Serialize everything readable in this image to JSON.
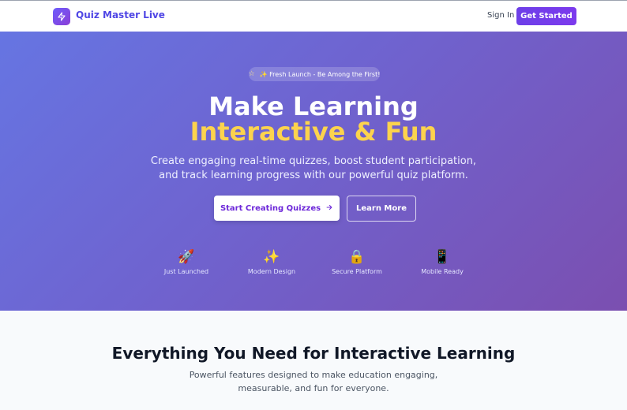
{
  "nav": {
    "brand": "Quiz Master Live",
    "logo_icon": "lightning-bolt-icon",
    "signin": "Sign In",
    "get_started": "Get Started"
  },
  "hero": {
    "badge_icon": "star-icon",
    "badge": "✨ Fresh Launch - Be Among the First!",
    "title_line1": "Make Learning",
    "title_line2": "Interactive & Fun",
    "subtitle": "Create engaging real-time quizzes, boost student participation, and track learning progress with our powerful quiz platform.",
    "primary_button": "Start Creating Quizzes",
    "secondary_button": "Learn More",
    "features": [
      {
        "icon": "🚀",
        "label": "Just Launched"
      },
      {
        "icon": "✨",
        "label": "Modern Design"
      },
      {
        "icon": "🔒",
        "label": "Secure Platform"
      },
      {
        "icon": "📱",
        "label": "Mobile Ready"
      }
    ]
  },
  "section": {
    "title": "Everything You Need for Interactive Learning",
    "subtitle": "Powerful features designed to make education engaging, measurable, and fun for everyone."
  },
  "colors": {
    "accent": "#7c3aed",
    "highlight": "#fcd34d",
    "hero_start": "#6675e2",
    "hero_end": "#7b4fb0"
  }
}
